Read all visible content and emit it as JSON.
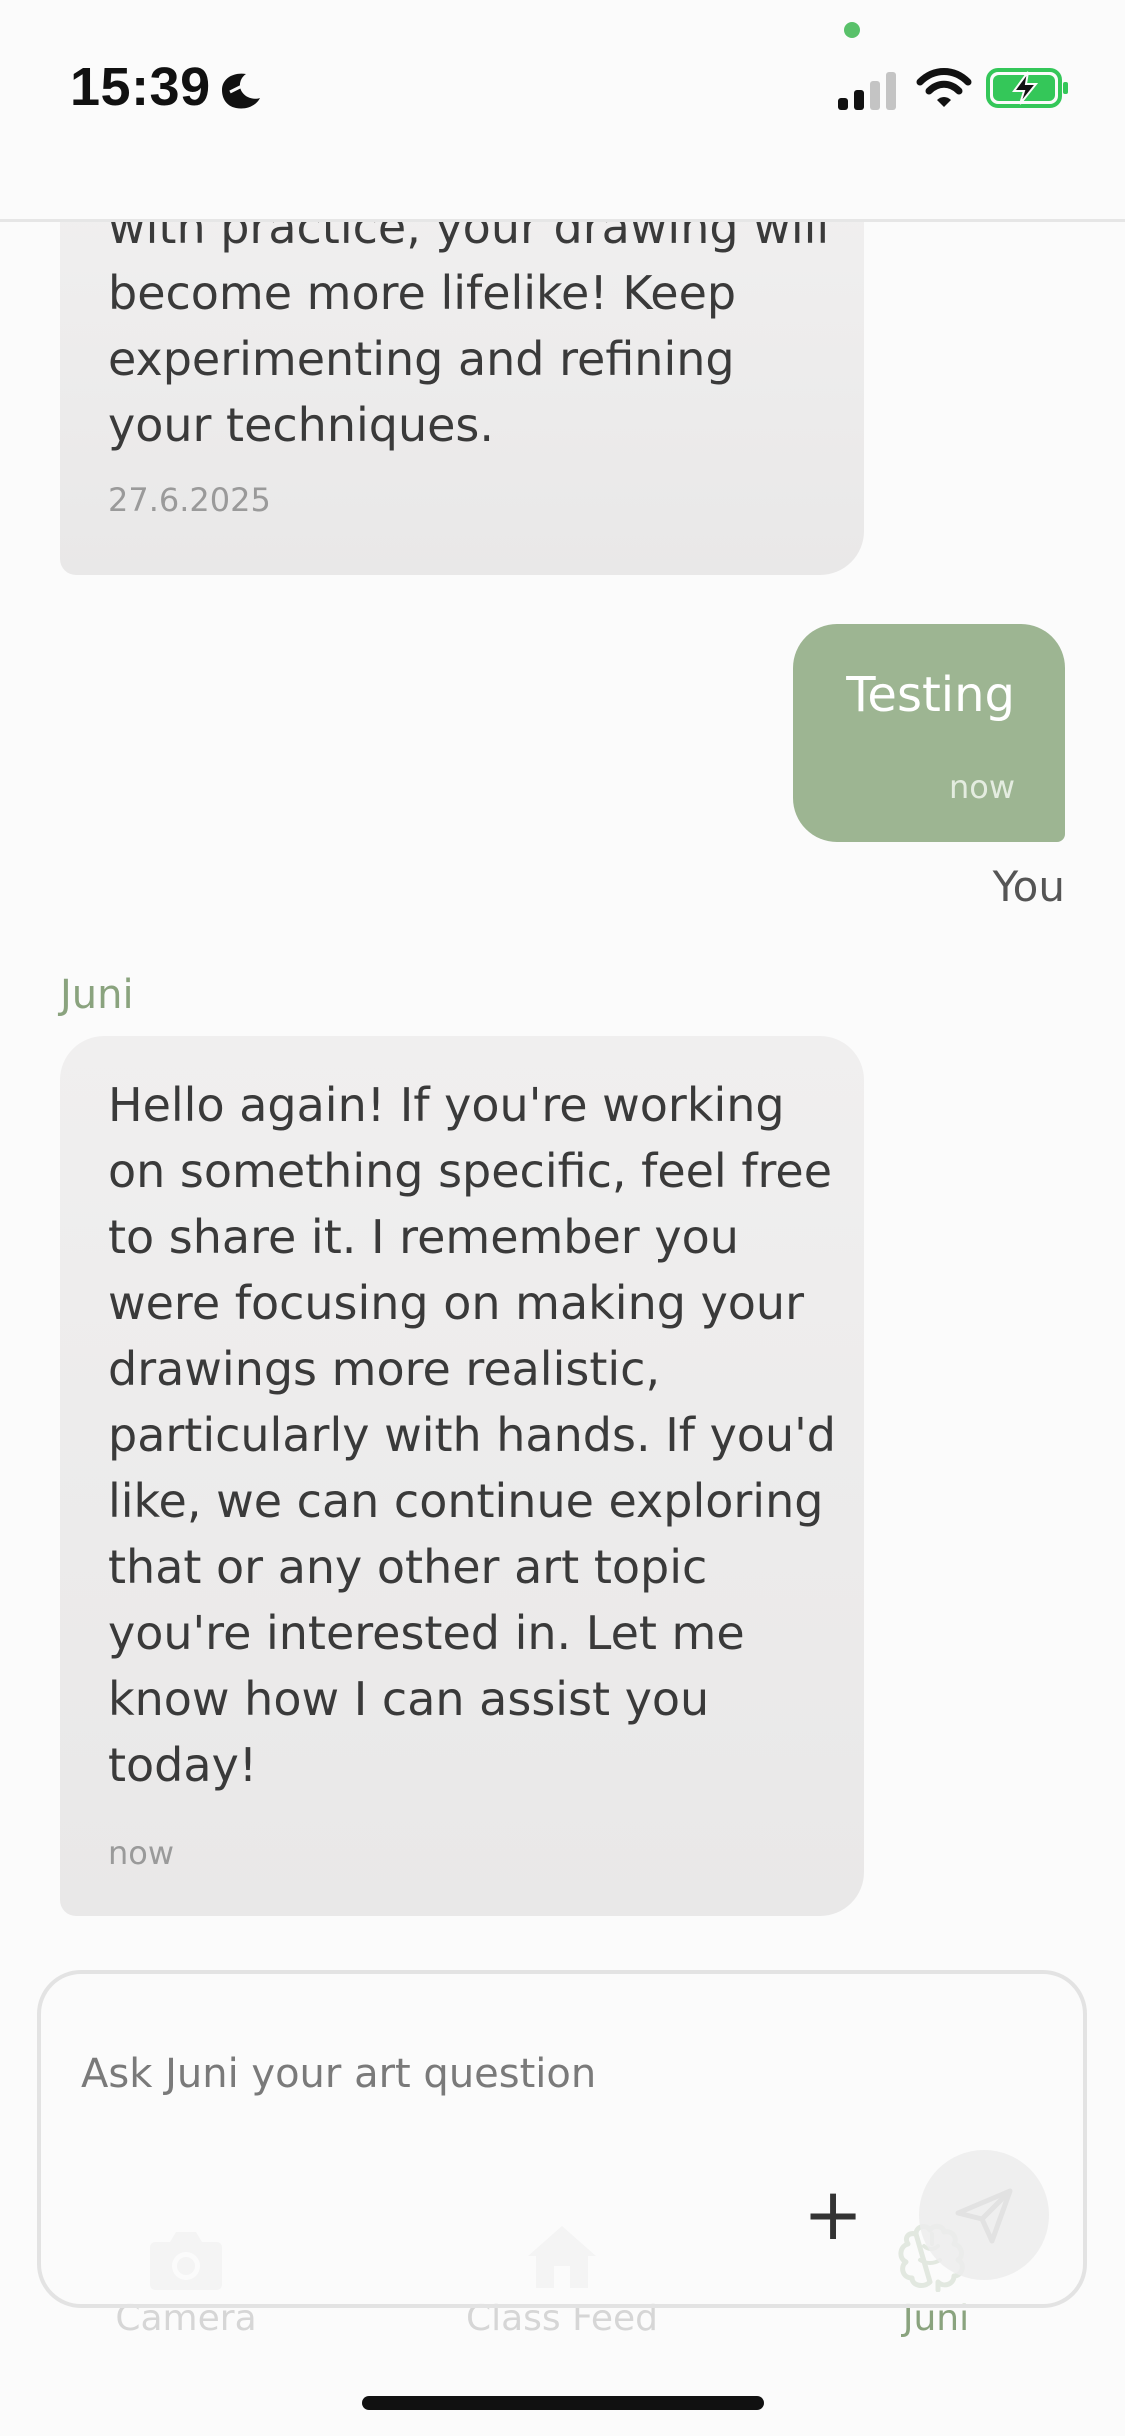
{
  "status_bar": {
    "time": "15:39",
    "focus_icon": "sleep-focus-icon",
    "signal_icon": "cellular-signal-icon",
    "wifi_icon": "wifi-icon",
    "battery_icon": "battery-charging-icon",
    "battery_color": "#34c759",
    "camera_indicator_color": "#59c16a"
  },
  "chat": {
    "messages": [
      {
        "sender": "",
        "text": "with practice, your drawing will become more lifelike! Keep experimenting and refining your techniques.",
        "time": "27.6.2025"
      },
      {
        "sender": "You",
        "text": "Testing",
        "time": "now"
      },
      {
        "sender": "Juni",
        "text": "Hello again! If you're working on something specific, feel free to share it. I remember you were focusing on making your drawings more realistic, particularly with hands. If you'd like, we can continue exploring that or any other art topic you're interested in. Let me know how I can assist you today!",
        "time": "now"
      }
    ]
  },
  "input": {
    "placeholder": "Ask Juni your art question",
    "value": "",
    "add_label": "+",
    "send_icon": "paper-plane-icon"
  },
  "tabs": [
    {
      "label": "Camera",
      "icon": "camera-icon",
      "active": false
    },
    {
      "label": "Class Feed",
      "icon": "home-icon",
      "active": false
    },
    {
      "label": "Juni",
      "icon": "brain-icon",
      "active": true
    }
  ],
  "colors": {
    "accent": "#8aa37e",
    "user_bubble": "#9db592",
    "assistant_bubble": "#ececec",
    "background": "#fbfbfb"
  }
}
